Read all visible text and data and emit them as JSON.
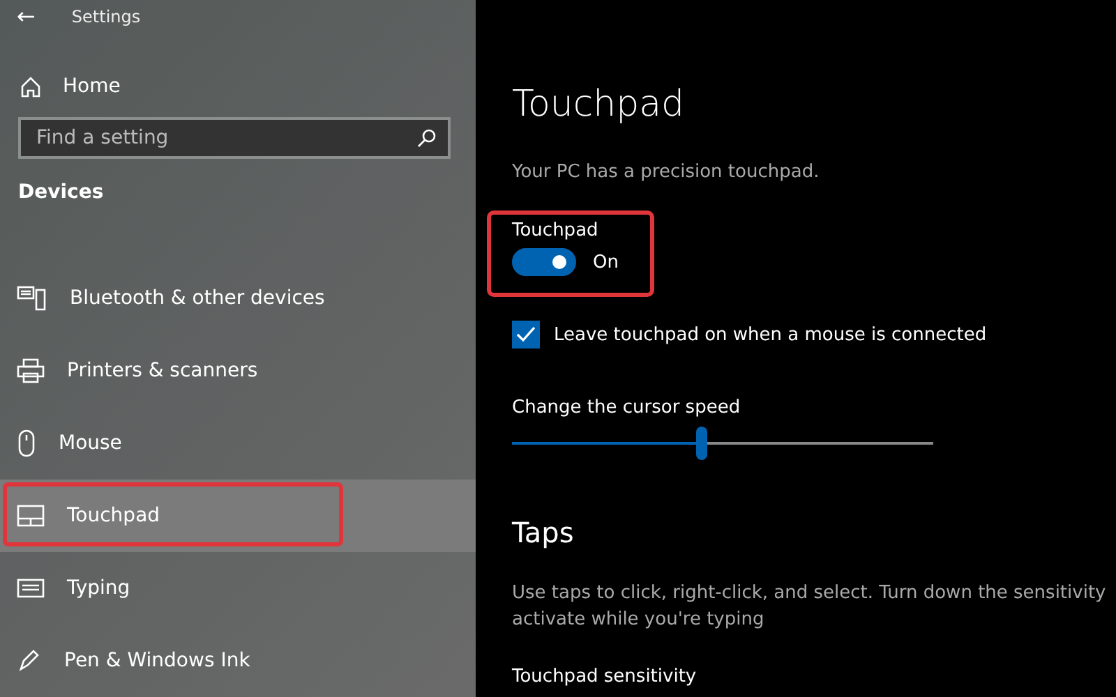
{
  "window": {
    "title": "Settings",
    "back": "←"
  },
  "sidebar": {
    "home": "Home",
    "search": {
      "placeholder": "Find a setting"
    },
    "section": "Devices",
    "items": [
      {
        "label": "Bluetooth & other devices",
        "kind": "bluetooth",
        "selected": false,
        "highlighted": false
      },
      {
        "label": "Printers & scanners",
        "kind": "printer",
        "selected": false,
        "highlighted": false
      },
      {
        "label": "Mouse",
        "kind": "mouse",
        "selected": false,
        "highlighted": false
      },
      {
        "label": "Touchpad",
        "kind": "touchpad",
        "selected": true,
        "highlighted": true
      },
      {
        "label": "Typing",
        "kind": "keyboard",
        "selected": false,
        "highlighted": false
      },
      {
        "label": "Pen & Windows Ink",
        "kind": "pen",
        "selected": false,
        "highlighted": false
      }
    ]
  },
  "main": {
    "title": "Touchpad",
    "subtitle": "Your PC has a precision touchpad.",
    "toggle": {
      "label": "Touchpad",
      "on": true,
      "state": "On",
      "highlighted": true
    },
    "checkbox": {
      "label": "Leave touchpad on when a mouse is connected",
      "checked": true
    },
    "slider": {
      "label": "Change the cursor speed",
      "level": 0.45
    },
    "taps": {
      "heading": "Taps",
      "lines": [
        "Use taps to click, right-click, and select. Turn down the sensitivity",
        "activate while you're typing"
      ],
      "sensitivity_label": "Touchpad sensitivity"
    }
  }
}
